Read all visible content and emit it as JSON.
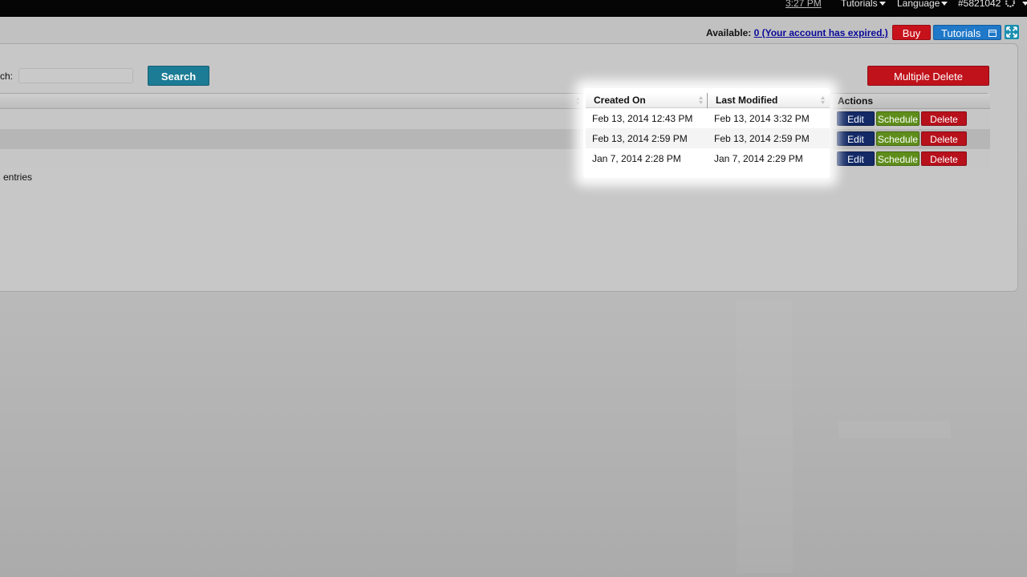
{
  "topbar": {
    "time": "3:27 PM",
    "tutorials_menu": "Tutorials",
    "language_menu": "Language",
    "account_id": "#5821042"
  },
  "account": {
    "available_label": "Available:",
    "available_link": "0 (Your account has expired.)",
    "buy_label": "Buy",
    "tutorials_label": "Tutorials"
  },
  "search": {
    "label": "ch:",
    "value": "",
    "button_label": "Search"
  },
  "multiple_delete_label": "Multiple Delete",
  "table": {
    "columns": [
      "Created On",
      "Last Modified",
      "Actions"
    ],
    "rows": [
      {
        "created": "Feb 13, 2014 12:43 PM",
        "modified": "Feb 13, 2014 3:32 PM"
      },
      {
        "created": "Feb 13, 2014 2:59 PM",
        "modified": "Feb 13, 2014 2:59 PM"
      },
      {
        "created": "Jan 7, 2014 2:28 PM",
        "modified": "Jan 7, 2014 2:29 PM"
      }
    ],
    "actions": {
      "edit": "Edit",
      "schedule": "Schedule",
      "delete": "Delete"
    }
  },
  "footer_entries": "entries",
  "colors": {
    "buy": "#c7121c",
    "tutorials": "#1f78c8",
    "search": "#1c7b95",
    "edit": "#132a66",
    "schedule": "#5e8d1b",
    "delete": "#b7111c"
  }
}
